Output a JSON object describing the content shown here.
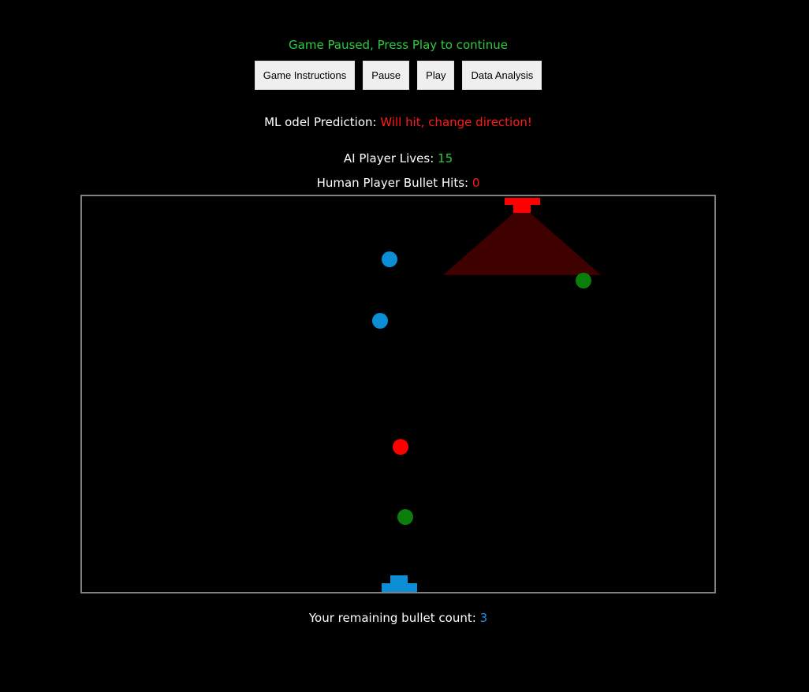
{
  "status": {
    "message": "Game Paused, Press Play to continue",
    "color": "#2ecc40"
  },
  "toolbar": {
    "instructions_label": "Game Instructions",
    "pause_label": "Pause",
    "play_label": "Play",
    "analysis_label": "Data Analysis"
  },
  "prediction": {
    "label": "ML odel Prediction: ",
    "value": "Will hit, change direction!",
    "color": "#ff1a1a"
  },
  "ai_lives": {
    "label": "AI Player Lives: ",
    "value": "15",
    "color": "#2ecc40"
  },
  "human_hits": {
    "label": "Human Player Bullet Hits: ",
    "value": "0",
    "color": "#ff1a1a"
  },
  "bullet_count": {
    "label": "Your remaining bullet count: ",
    "value": "3",
    "color": "#1e90e0"
  },
  "colors": {
    "background": "#000000",
    "arena_border": "#808080",
    "ai_player": "#ff0000",
    "ai_vision_cone": "#3f0000",
    "human_player": "#0b8ed6",
    "bullet_blue": "#0b8ed6",
    "bullet_red": "#ff0000",
    "bullet_green": "#0a7d0a"
  }
}
